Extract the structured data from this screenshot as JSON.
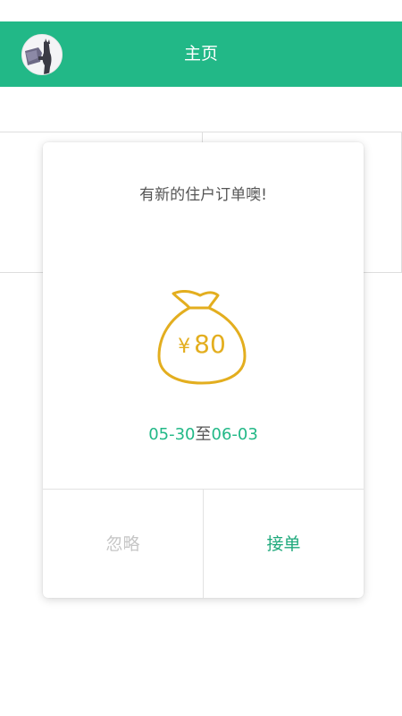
{
  "header": {
    "title": "主页",
    "background_color": "#22b887"
  },
  "modal": {
    "message": "有新的住户订单噢!",
    "currency_symbol": "¥",
    "amount": "80",
    "date_start": "05-30",
    "date_separator": "至",
    "date_end": "06-03",
    "icon": "money-bag-icon",
    "ignore_label": "忽略",
    "accept_label": "接单",
    "accent_color": "#e3ae1f"
  }
}
